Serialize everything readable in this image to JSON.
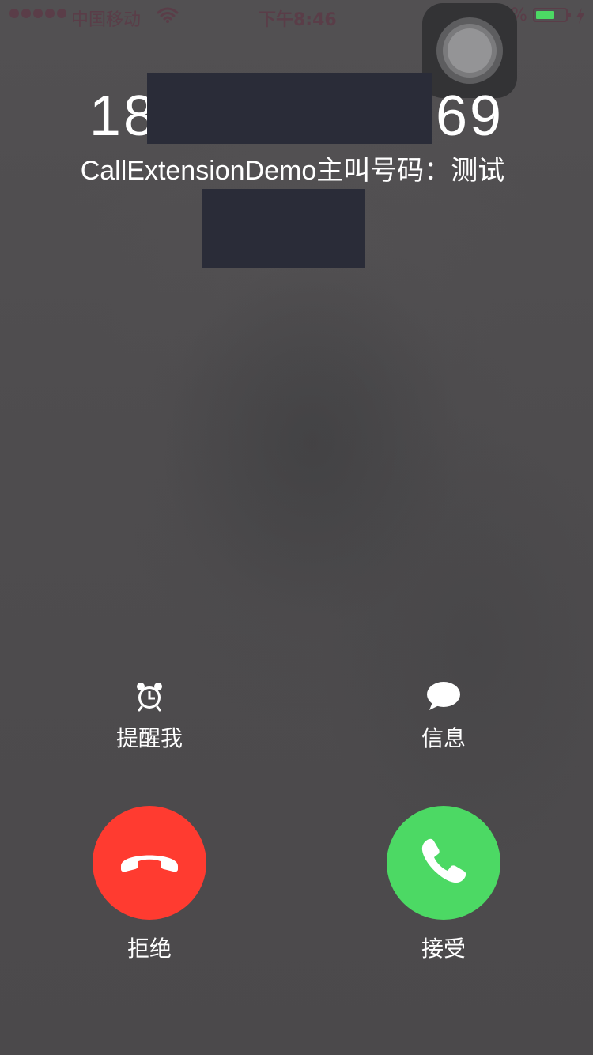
{
  "status_bar": {
    "carrier": "中国移动",
    "time": "下午8:46",
    "battery_percent": "63%",
    "battery_level": 0.63,
    "signal_bars": 5,
    "icons": [
      "signal-dots-icon",
      "wifi-icon",
      "orientation-lock-icon",
      "battery-icon",
      "charging-bolt-icon"
    ]
  },
  "caller": {
    "number_prefix": "18",
    "number_suffix": "69",
    "label": "CallExtensionDemo主叫号码：测试"
  },
  "actions": {
    "remind_label": "提醒我",
    "remind_icon": "alarm-clock-icon",
    "message_label": "信息",
    "message_icon": "speech-bubble-icon"
  },
  "buttons": {
    "decline_label": "拒绝",
    "decline_icon": "hang-up-phone-icon",
    "decline_color": "#ff3b30",
    "accept_label": "接受",
    "accept_icon": "phone-icon",
    "accept_color": "#4cd964"
  }
}
